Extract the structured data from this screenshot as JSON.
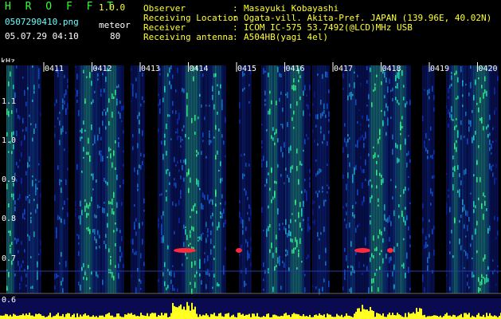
{
  "app": {
    "title": "H R O F F T",
    "version": "1.0.0"
  },
  "file": {
    "name": "0507290410.png",
    "datetime": "05.07.29 04:10"
  },
  "meteor": {
    "label": "meteor",
    "count": "80"
  },
  "station": [
    {
      "label": "Observer",
      "value": "Masayuki Kobayashi"
    },
    {
      "label": "Receiving Location",
      "value": "Ogata-vill. Akita-Pref. JAPAN (139.96E, 40.02N)"
    },
    {
      "label": "Receiver",
      "value": "ICOM IC-575 53.7492(@LCD)MHz USB"
    },
    {
      "label": "Receiving antenna",
      "value": "A504HB(yagi 4el)"
    }
  ],
  "separator": ":",
  "y_axis": {
    "unit": "kHz",
    "ticks": [
      "1.1",
      "1.0",
      "0.9",
      "0.8",
      "0.7",
      "0.6"
    ]
  },
  "time_ticks": [
    "0411",
    "0412",
    "0413",
    "0414",
    "0415",
    "0416",
    "0417",
    "0418",
    "0419",
    "0420"
  ],
  "colors": {
    "background": "#000000",
    "header_green": "#33ff33",
    "header_yellow": "#ffff33",
    "tick_label": "#ffffff",
    "noise_low": "#0a1a8c",
    "noise_high": "#22e6c8",
    "echo": "#ff2a3c",
    "activity": "#ffff22"
  }
}
